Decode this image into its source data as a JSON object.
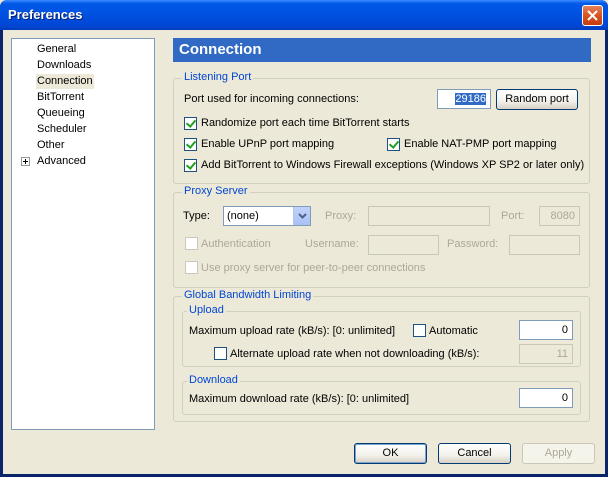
{
  "window": {
    "title": "Preferences"
  },
  "tree": {
    "items": [
      {
        "label": "General"
      },
      {
        "label": "Downloads"
      },
      {
        "label": "Connection"
      },
      {
        "label": "BitTorrent"
      },
      {
        "label": "Queueing"
      },
      {
        "label": "Scheduler"
      },
      {
        "label": "Other"
      },
      {
        "label": "Advanced"
      }
    ],
    "selected": "Connection"
  },
  "page": {
    "header": "Connection"
  },
  "listening": {
    "title": "Listening Port",
    "port_label": "Port used for incoming connections:",
    "port_value": "29186",
    "random_port_button": "Random port",
    "randomize_label": "Randomize port each time BitTorrent starts",
    "randomize_checked": true,
    "upnp_label": "Enable UPnP port mapping",
    "upnp_checked": true,
    "natpmp_label": "Enable NAT-PMP port mapping",
    "natpmp_checked": true,
    "firewall_label": "Add BitTorrent to Windows Firewall exceptions (Windows XP SP2 or later only)",
    "firewall_checked": true
  },
  "proxy": {
    "title": "Proxy Server",
    "type_label": "Type:",
    "type_value": "(none)",
    "proxy_label": "Proxy:",
    "proxy_value": "",
    "port_label": "Port:",
    "port_value": "8080",
    "auth_label": "Authentication",
    "auth_checked": false,
    "username_label": "Username:",
    "username_value": "",
    "password_label": "Password:",
    "password_value": "",
    "p2p_label": "Use proxy server for peer-to-peer connections",
    "p2p_checked": false
  },
  "bandwidth": {
    "title": "Global Bandwidth Limiting",
    "upload": {
      "title": "Upload",
      "max_label": "Maximum upload rate (kB/s): [0: unlimited]",
      "automatic_label": "Automatic",
      "automatic_checked": false,
      "max_value": "0",
      "alt_label": "Alternate upload rate when not downloading (kB/s):",
      "alt_checked": false,
      "alt_value": "11"
    },
    "download": {
      "title": "Download",
      "max_label": "Maximum download rate (kB/s): [0: unlimited]",
      "max_value": "0"
    }
  },
  "buttons": {
    "ok": "OK",
    "cancel": "Cancel",
    "apply": "Apply"
  }
}
